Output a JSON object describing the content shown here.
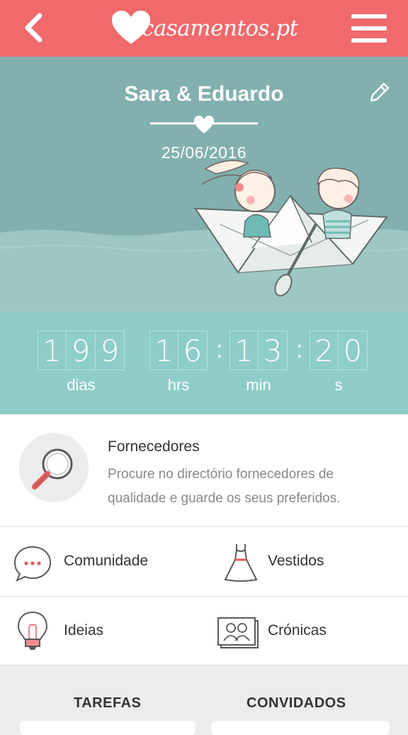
{
  "header": {
    "logo_text": "casamentos.pt",
    "accent": "#f0696b"
  },
  "hero": {
    "couple": "Sara & Eduardo",
    "date": "25/06/2016"
  },
  "countdown": {
    "days": [
      "1",
      "9",
      "9"
    ],
    "hours": [
      "1",
      "6"
    ],
    "minutes": [
      "1",
      "3"
    ],
    "seconds": [
      "2",
      "0"
    ],
    "labels": {
      "days": "dias",
      "hours": "hrs",
      "minutes": "min",
      "seconds": "s"
    }
  },
  "fornecedores": {
    "title": "Fornecedores",
    "line1": "Procure no directório fornecedores de",
    "line2": "qualidade e guarde os seus preferidos."
  },
  "grid": {
    "comunidade": "Comunidade",
    "vestidos": "Vestidos",
    "ideias": "Ideias",
    "cronicas": "Crónicas"
  },
  "tabs": {
    "tarefas": "TAREFAS",
    "convidados": "CONVIDADOS"
  }
}
